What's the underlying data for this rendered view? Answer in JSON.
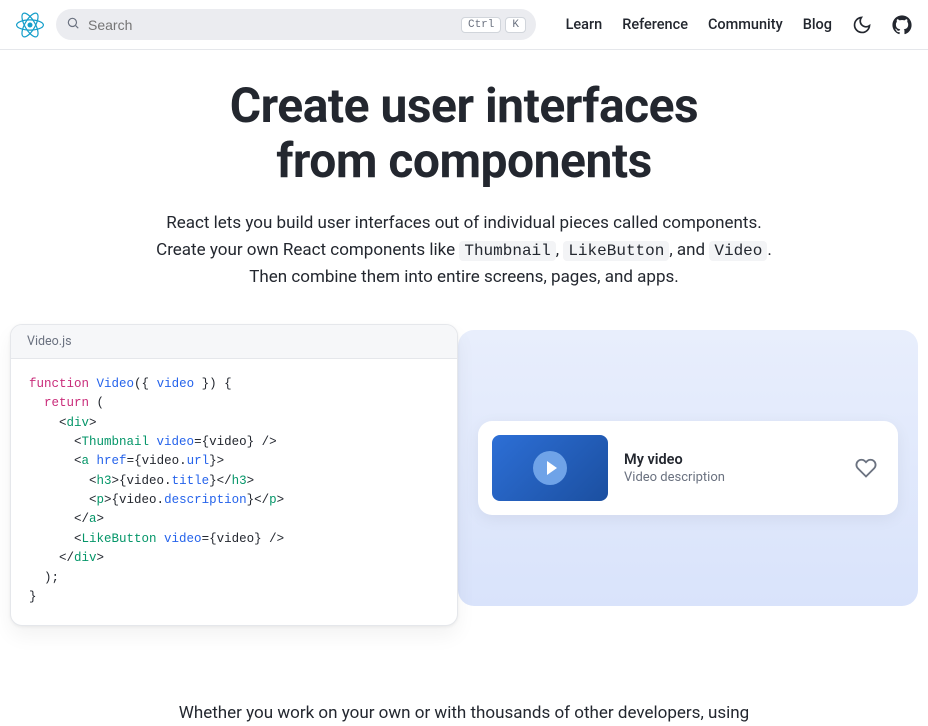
{
  "header": {
    "search_placeholder": "Search",
    "kbd1": "Ctrl",
    "kbd2": "K",
    "nav": {
      "learn": "Learn",
      "reference": "Reference",
      "community": "Community",
      "blog": "Blog"
    }
  },
  "hero": {
    "title_line1": "Create user interfaces",
    "title_line2": "from components",
    "p_part1": "React lets you build user interfaces out of individual pieces called components. Create your own React components like ",
    "code1": "Thumbnail",
    "p_part2": ", ",
    "code2": "LikeButton",
    "p_part3": ", and ",
    "code3": "Video",
    "p_part4": ". Then combine them into entire screens, pages, and apps."
  },
  "code_file": "Video.js",
  "preview": {
    "title": "My video",
    "description": "Video description"
  },
  "footer": "Whether you work on your own or with thousands of other developers, using"
}
